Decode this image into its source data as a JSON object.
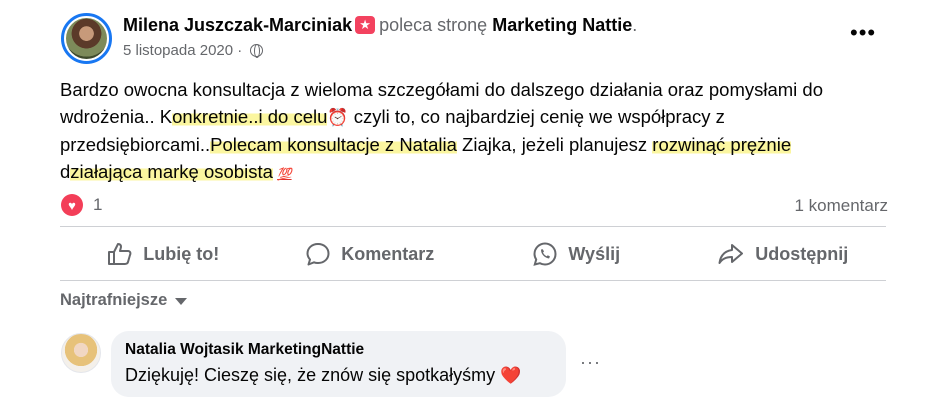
{
  "post": {
    "author": "Milena Juszczak-Marciniak",
    "recommends_text": "poleca stronę",
    "page_name": "Marketing Nattie",
    "period": ".",
    "date": "5 listopada 2020",
    "date_sep": "·",
    "privacy_icon": "globe-icon",
    "more_label": "•••",
    "text": {
      "p1": "Bardzo owocna konsultacja z wieloma szczegółami do dalszego działania oraz pomysłami do wdrożenia.. K",
      "h1": "onkretnie..i do celu",
      "clock": "⏰",
      "p2": " czyli to, co najbardziej cenię we współpracy z przedsiębiorcami..",
      "h2": "Polecam konsultacje z Natalia",
      "p3": " Ziajka, jeżeli planujesz ",
      "h3": "rozwinąć prężnie",
      "p4": " d",
      "h4": "ziałająca markę osobista",
      "hundred": "💯"
    },
    "reaction_icon": "heart-icon",
    "reaction_count": "1",
    "comment_count": "1 komentarz"
  },
  "actions": {
    "like": "Lubię to!",
    "comment": "Komentarz",
    "send": "Wyślij",
    "share": "Udostępnij"
  },
  "comments": {
    "sort_label": "Najtrafniejsze",
    "items": [
      {
        "author": "Natalia Wojtasik MarketingNattie",
        "text": "Dziękuję! Cieszę się, że znów się spotkałyśmy",
        "emoji": "❤️"
      }
    ],
    "more_label": "···"
  },
  "colors": {
    "accent": "#1877f2",
    "reaction": "#f33e58",
    "highlight": "#fbf6a0",
    "secondary_text": "#65676b"
  }
}
